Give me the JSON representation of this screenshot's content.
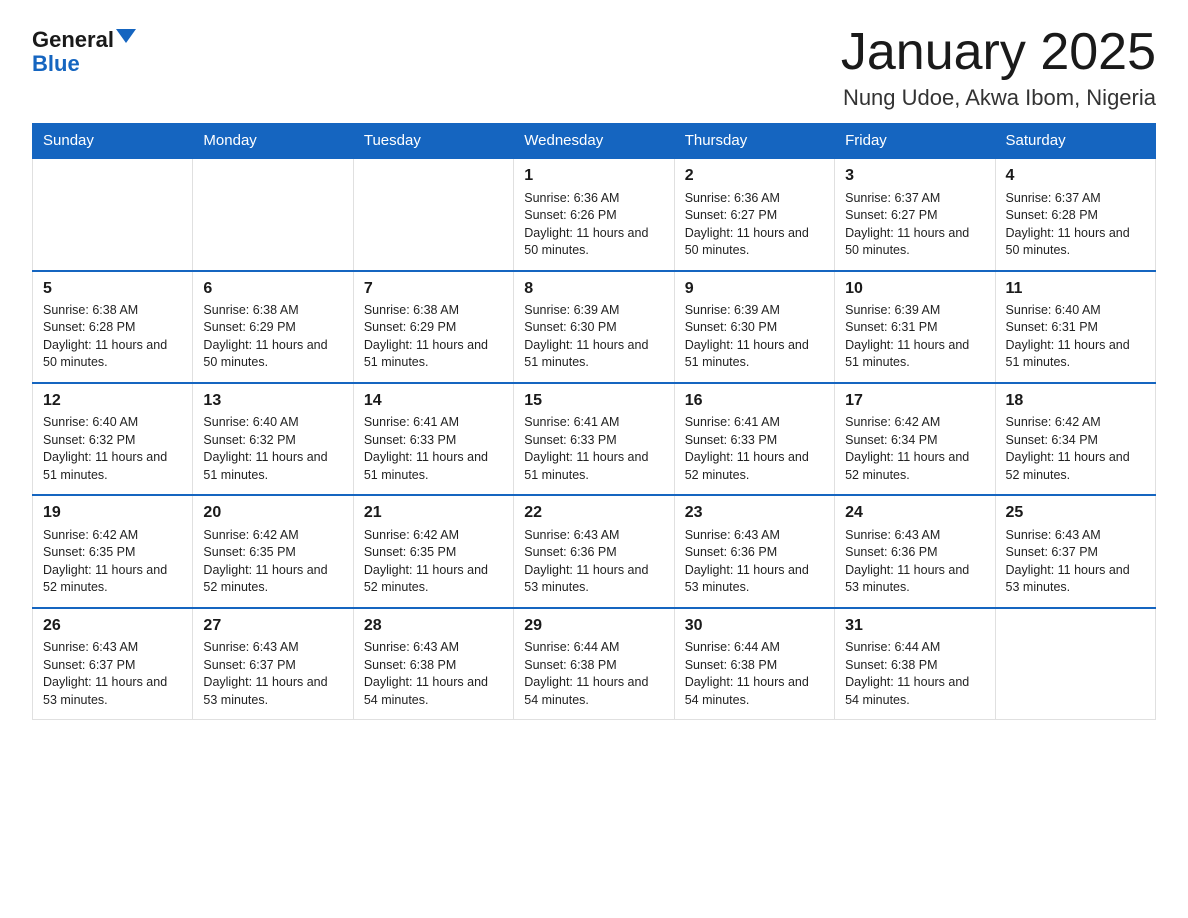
{
  "logo": {
    "text_general": "General",
    "text_blue": "Blue"
  },
  "header": {
    "title": "January 2025",
    "subtitle": "Nung Udoe, Akwa Ibom, Nigeria"
  },
  "weekdays": [
    "Sunday",
    "Monday",
    "Tuesday",
    "Wednesday",
    "Thursday",
    "Friday",
    "Saturday"
  ],
  "weeks": [
    [
      {
        "day": "",
        "info": ""
      },
      {
        "day": "",
        "info": ""
      },
      {
        "day": "",
        "info": ""
      },
      {
        "day": "1",
        "info": "Sunrise: 6:36 AM\nSunset: 6:26 PM\nDaylight: 11 hours and 50 minutes."
      },
      {
        "day": "2",
        "info": "Sunrise: 6:36 AM\nSunset: 6:27 PM\nDaylight: 11 hours and 50 minutes."
      },
      {
        "day": "3",
        "info": "Sunrise: 6:37 AM\nSunset: 6:27 PM\nDaylight: 11 hours and 50 minutes."
      },
      {
        "day": "4",
        "info": "Sunrise: 6:37 AM\nSunset: 6:28 PM\nDaylight: 11 hours and 50 minutes."
      }
    ],
    [
      {
        "day": "5",
        "info": "Sunrise: 6:38 AM\nSunset: 6:28 PM\nDaylight: 11 hours and 50 minutes."
      },
      {
        "day": "6",
        "info": "Sunrise: 6:38 AM\nSunset: 6:29 PM\nDaylight: 11 hours and 50 minutes."
      },
      {
        "day": "7",
        "info": "Sunrise: 6:38 AM\nSunset: 6:29 PM\nDaylight: 11 hours and 51 minutes."
      },
      {
        "day": "8",
        "info": "Sunrise: 6:39 AM\nSunset: 6:30 PM\nDaylight: 11 hours and 51 minutes."
      },
      {
        "day": "9",
        "info": "Sunrise: 6:39 AM\nSunset: 6:30 PM\nDaylight: 11 hours and 51 minutes."
      },
      {
        "day": "10",
        "info": "Sunrise: 6:39 AM\nSunset: 6:31 PM\nDaylight: 11 hours and 51 minutes."
      },
      {
        "day": "11",
        "info": "Sunrise: 6:40 AM\nSunset: 6:31 PM\nDaylight: 11 hours and 51 minutes."
      }
    ],
    [
      {
        "day": "12",
        "info": "Sunrise: 6:40 AM\nSunset: 6:32 PM\nDaylight: 11 hours and 51 minutes."
      },
      {
        "day": "13",
        "info": "Sunrise: 6:40 AM\nSunset: 6:32 PM\nDaylight: 11 hours and 51 minutes."
      },
      {
        "day": "14",
        "info": "Sunrise: 6:41 AM\nSunset: 6:33 PM\nDaylight: 11 hours and 51 minutes."
      },
      {
        "day": "15",
        "info": "Sunrise: 6:41 AM\nSunset: 6:33 PM\nDaylight: 11 hours and 51 minutes."
      },
      {
        "day": "16",
        "info": "Sunrise: 6:41 AM\nSunset: 6:33 PM\nDaylight: 11 hours and 52 minutes."
      },
      {
        "day": "17",
        "info": "Sunrise: 6:42 AM\nSunset: 6:34 PM\nDaylight: 11 hours and 52 minutes."
      },
      {
        "day": "18",
        "info": "Sunrise: 6:42 AM\nSunset: 6:34 PM\nDaylight: 11 hours and 52 minutes."
      }
    ],
    [
      {
        "day": "19",
        "info": "Sunrise: 6:42 AM\nSunset: 6:35 PM\nDaylight: 11 hours and 52 minutes."
      },
      {
        "day": "20",
        "info": "Sunrise: 6:42 AM\nSunset: 6:35 PM\nDaylight: 11 hours and 52 minutes."
      },
      {
        "day": "21",
        "info": "Sunrise: 6:42 AM\nSunset: 6:35 PM\nDaylight: 11 hours and 52 minutes."
      },
      {
        "day": "22",
        "info": "Sunrise: 6:43 AM\nSunset: 6:36 PM\nDaylight: 11 hours and 53 minutes."
      },
      {
        "day": "23",
        "info": "Sunrise: 6:43 AM\nSunset: 6:36 PM\nDaylight: 11 hours and 53 minutes."
      },
      {
        "day": "24",
        "info": "Sunrise: 6:43 AM\nSunset: 6:36 PM\nDaylight: 11 hours and 53 minutes."
      },
      {
        "day": "25",
        "info": "Sunrise: 6:43 AM\nSunset: 6:37 PM\nDaylight: 11 hours and 53 minutes."
      }
    ],
    [
      {
        "day": "26",
        "info": "Sunrise: 6:43 AM\nSunset: 6:37 PM\nDaylight: 11 hours and 53 minutes."
      },
      {
        "day": "27",
        "info": "Sunrise: 6:43 AM\nSunset: 6:37 PM\nDaylight: 11 hours and 53 minutes."
      },
      {
        "day": "28",
        "info": "Sunrise: 6:43 AM\nSunset: 6:38 PM\nDaylight: 11 hours and 54 minutes."
      },
      {
        "day": "29",
        "info": "Sunrise: 6:44 AM\nSunset: 6:38 PM\nDaylight: 11 hours and 54 minutes."
      },
      {
        "day": "30",
        "info": "Sunrise: 6:44 AM\nSunset: 6:38 PM\nDaylight: 11 hours and 54 minutes."
      },
      {
        "day": "31",
        "info": "Sunrise: 6:44 AM\nSunset: 6:38 PM\nDaylight: 11 hours and 54 minutes."
      },
      {
        "day": "",
        "info": ""
      }
    ]
  ]
}
